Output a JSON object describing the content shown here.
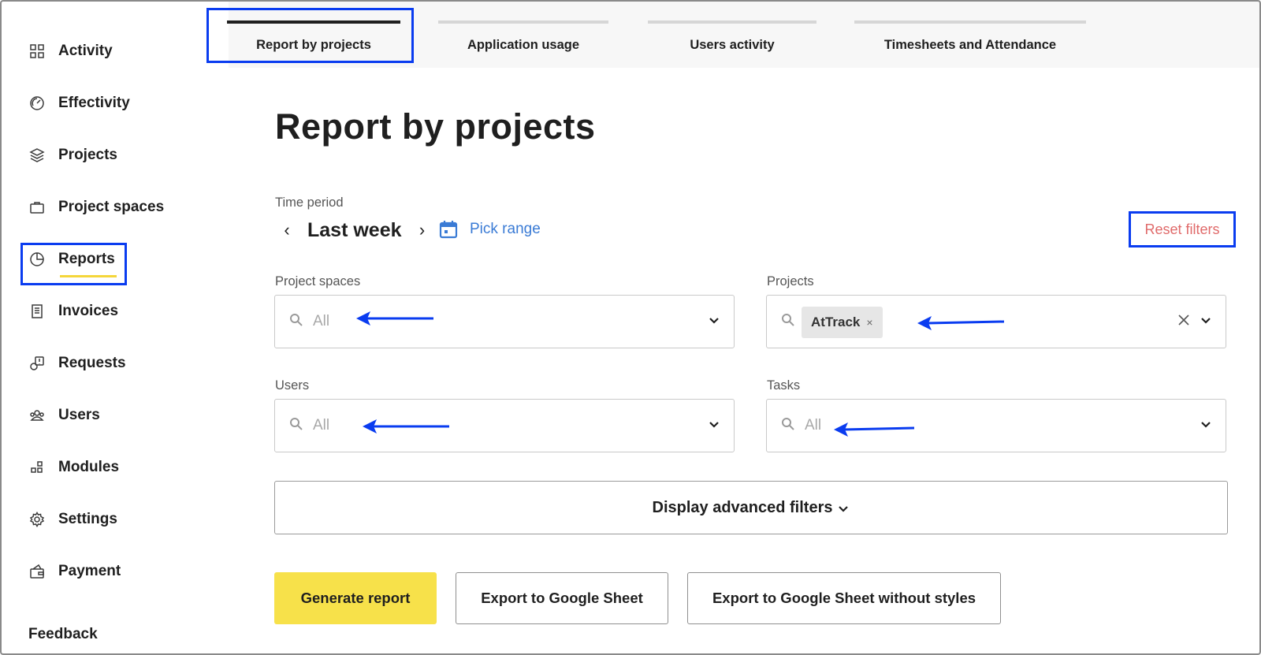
{
  "sidebar": {
    "items": [
      {
        "label": "Activity",
        "icon": "grid-icon"
      },
      {
        "label": "Effectivity",
        "icon": "gauge-icon"
      },
      {
        "label": "Projects",
        "icon": "layers-icon"
      },
      {
        "label": "Project spaces",
        "icon": "briefcase-icon"
      },
      {
        "label": "Reports",
        "icon": "pie-chart-icon",
        "active": true
      },
      {
        "label": "Invoices",
        "icon": "receipt-icon"
      },
      {
        "label": "Requests",
        "icon": "request-icon"
      },
      {
        "label": "Users",
        "icon": "users-icon"
      },
      {
        "label": "Modules",
        "icon": "modules-icon"
      },
      {
        "label": "Settings",
        "icon": "gear-icon"
      },
      {
        "label": "Payment",
        "icon": "wallet-icon"
      }
    ],
    "feedback": "Feedback",
    "accent": "#f5d63a"
  },
  "tabs": [
    {
      "label": "Report by projects",
      "active": true
    },
    {
      "label": "Application usage"
    },
    {
      "label": "Users activity"
    },
    {
      "label": "Timesheets and Attendance"
    }
  ],
  "main": {
    "title": "Report by projects",
    "time_period": {
      "label": "Time period",
      "value": "Last week",
      "prev": "‹",
      "next": "›",
      "pick_range": "Pick range"
    },
    "reset_filters": "Reset filters",
    "filters": {
      "project_spaces": {
        "label": "Project spaces",
        "placeholder": "All"
      },
      "projects": {
        "label": "Projects",
        "selected": "AtTrack",
        "chip_remove": "×"
      },
      "users": {
        "label": "Users",
        "placeholder": "All"
      },
      "tasks": {
        "label": "Tasks",
        "placeholder": "All"
      }
    },
    "advanced_filters": "Display advanced filters",
    "actions": {
      "generate": "Generate report",
      "export": "Export to Google Sheet",
      "export_no_styles": "Export to Google Sheet without styles"
    }
  },
  "colors": {
    "annotation_blue": "#0a3cf0",
    "primary_button": "#f7e14a",
    "link_blue": "#3a7bd5",
    "reset_red": "#e06a6a"
  }
}
